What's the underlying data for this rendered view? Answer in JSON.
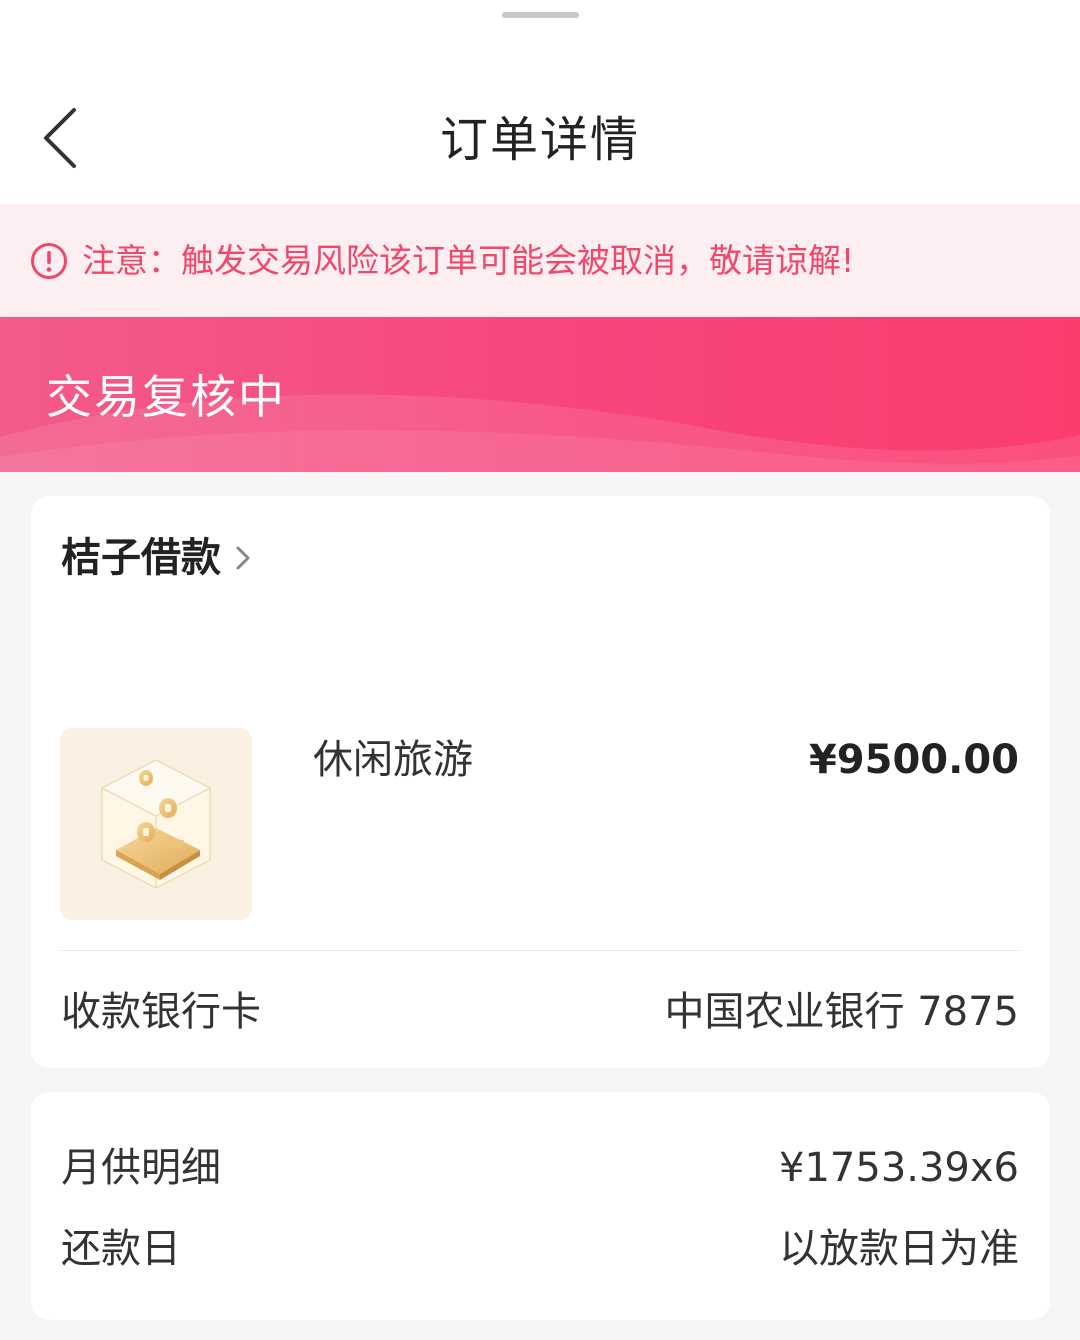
{
  "header": {
    "title": "订单详情",
    "back_icon": "chevron-left-icon"
  },
  "notice": {
    "icon": "exclamation-circle-icon",
    "text": "注意：触发交易风险该订单可能会被取消，敬请谅解!",
    "color": "#f0476a",
    "background": "#fdeef1"
  },
  "status": {
    "text": "交易复核中",
    "gradient_start": "#f25b8a",
    "gradient_end": "#fb3d6e"
  },
  "order": {
    "product_name": "桔子借款",
    "item_name": "休闲旅游",
    "item_price": "¥9500.00",
    "bank_card_label": "收款银行卡",
    "bank_card_value": "中国农业银行 7875"
  },
  "repayment": {
    "monthly_label": "月供明细",
    "monthly_value": "¥1753.39x6",
    "due_label": "还款日",
    "due_value": "以放款日为准"
  }
}
